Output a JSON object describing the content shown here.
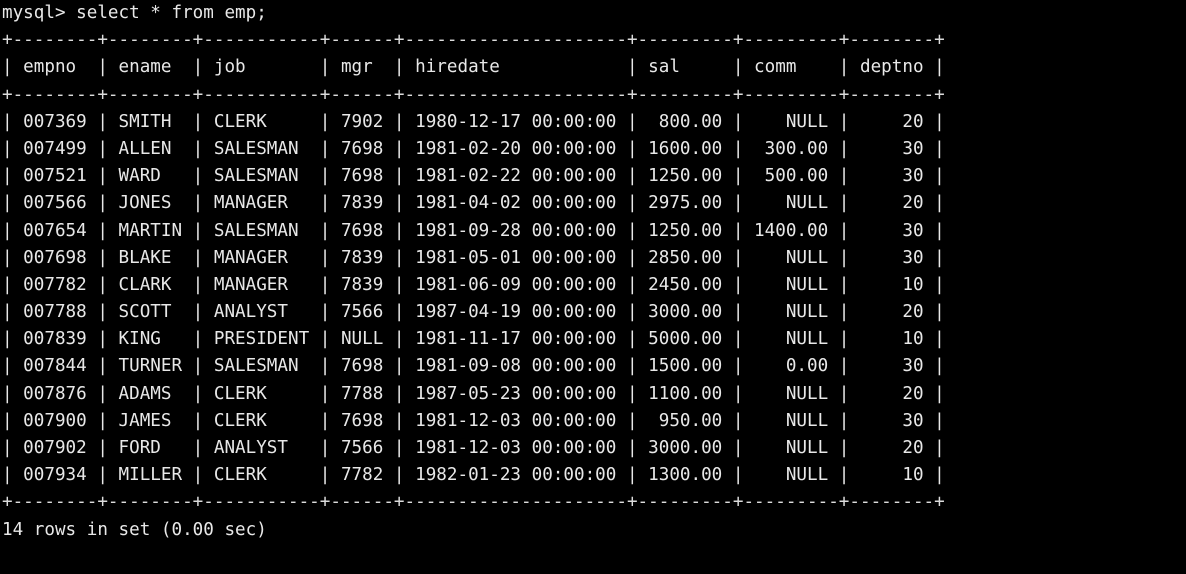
{
  "terminal": {
    "background_color": "#000000",
    "text_color": "#e8e8e8",
    "prompt": "mysql> ",
    "command": "select * from emp;",
    "prompt_line": "mysql> select * from emp;",
    "status": "14 rows in set (0.00 sec)",
    "row_count": 14,
    "elapsed": "0.00 sec"
  },
  "table": {
    "name": "emp",
    "columns": [
      {
        "name": "empno",
        "width": 6,
        "align": "right"
      },
      {
        "name": "ename",
        "width": 6,
        "align": "left"
      },
      {
        "name": "job",
        "width": 9,
        "align": "left"
      },
      {
        "name": "mgr",
        "width": 4,
        "align": "right"
      },
      {
        "name": "hiredate",
        "width": 19,
        "align": "left"
      },
      {
        "name": "sal",
        "width": 7,
        "align": "right"
      },
      {
        "name": "comm",
        "width": 7,
        "align": "right"
      },
      {
        "name": "deptno",
        "width": 6,
        "align": "right"
      }
    ],
    "rows": [
      [
        "007369",
        "SMITH",
        "CLERK",
        "7902",
        "1980-12-17 00:00:00",
        "800.00",
        "NULL",
        "20"
      ],
      [
        "007499",
        "ALLEN",
        "SALESMAN",
        "7698",
        "1981-02-20 00:00:00",
        "1600.00",
        "300.00",
        "30"
      ],
      [
        "007521",
        "WARD",
        "SALESMAN",
        "7698",
        "1981-02-22 00:00:00",
        "1250.00",
        "500.00",
        "30"
      ],
      [
        "007566",
        "JONES",
        "MANAGER",
        "7839",
        "1981-04-02 00:00:00",
        "2975.00",
        "NULL",
        "20"
      ],
      [
        "007654",
        "MARTIN",
        "SALESMAN",
        "7698",
        "1981-09-28 00:00:00",
        "1250.00",
        "1400.00",
        "30"
      ],
      [
        "007698",
        "BLAKE",
        "MANAGER",
        "7839",
        "1981-05-01 00:00:00",
        "2850.00",
        "NULL",
        "30"
      ],
      [
        "007782",
        "CLARK",
        "MANAGER",
        "7839",
        "1981-06-09 00:00:00",
        "2450.00",
        "NULL",
        "10"
      ],
      [
        "007788",
        "SCOTT",
        "ANALYST",
        "7566",
        "1987-04-19 00:00:00",
        "3000.00",
        "NULL",
        "20"
      ],
      [
        "007839",
        "KING",
        "PRESIDENT",
        "NULL",
        "1981-11-17 00:00:00",
        "5000.00",
        "NULL",
        "10"
      ],
      [
        "007844",
        "TURNER",
        "SALESMAN",
        "7698",
        "1981-09-08 00:00:00",
        "1500.00",
        "0.00",
        "30"
      ],
      [
        "007876",
        "ADAMS",
        "CLERK",
        "7788",
        "1987-05-23 00:00:00",
        "1100.00",
        "NULL",
        "20"
      ],
      [
        "007900",
        "JAMES",
        "CLERK",
        "7698",
        "1981-12-03 00:00:00",
        "950.00",
        "NULL",
        "30"
      ],
      [
        "007902",
        "FORD",
        "ANALYST",
        "7566",
        "1981-12-03 00:00:00",
        "3000.00",
        "NULL",
        "20"
      ],
      [
        "007934",
        "MILLER",
        "CLERK",
        "7782",
        "1982-01-23 00:00:00",
        "1300.00",
        "NULL",
        "10"
      ]
    ]
  }
}
